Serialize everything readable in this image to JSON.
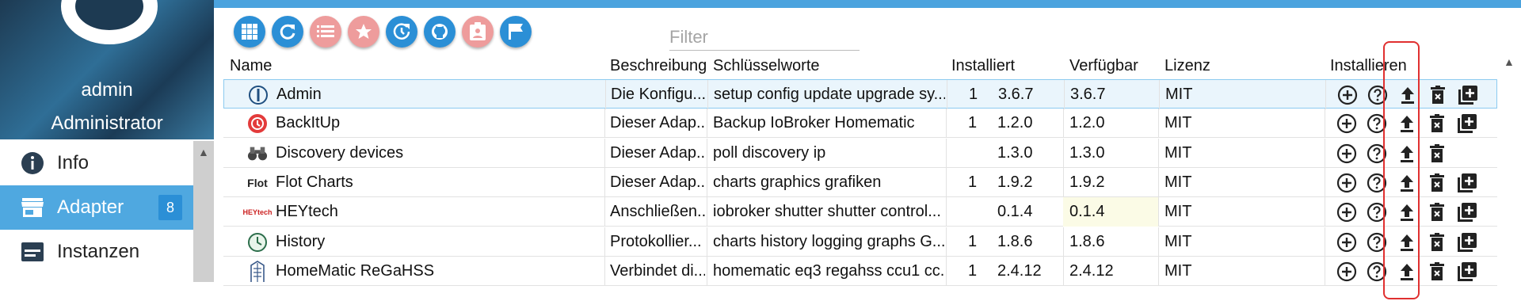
{
  "user": {
    "name": "admin",
    "role": "Administrator"
  },
  "menu": {
    "info": "Info",
    "adapter": "Adapter",
    "adapter_badge": "8",
    "instances": "Instanzen"
  },
  "filter": {
    "placeholder": "Filter"
  },
  "table": {
    "headers": {
      "name": "Name",
      "desc": "Beschreibung",
      "keywords": "Schlüsselworte",
      "installed": "Installiert",
      "available": "Verfügbar",
      "license": "Lizenz",
      "install": "Installieren"
    },
    "rows": [
      {
        "name": "Admin",
        "desc": "Die Konfigu...",
        "keywords": "setup config update upgrade sy...",
        "count": "1",
        "installed": "3.6.7",
        "available": "3.6.7",
        "license": "MIT",
        "icon": "admin-icon",
        "add": true
      },
      {
        "name": "BackItUp",
        "desc": "Dieser Adap...",
        "keywords": "Backup IoBroker Homematic",
        "count": "1",
        "installed": "1.2.0",
        "available": "1.2.0",
        "license": "MIT",
        "icon": "backitup-icon",
        "add": true
      },
      {
        "name": "Discovery devices",
        "desc": "Dieser Adap...",
        "keywords": "poll discovery ip",
        "count": "",
        "installed": "1.3.0",
        "available": "1.3.0",
        "license": "MIT",
        "icon": "binoculars-icon",
        "add": false
      },
      {
        "name": "Flot Charts",
        "desc": "Dieser Adap...",
        "keywords": "charts graphics grafiken",
        "count": "1",
        "installed": "1.9.2",
        "available": "1.9.2",
        "license": "MIT",
        "icon": "flot-icon",
        "icon_text": "Flot",
        "add": true
      },
      {
        "name": "HEYtech",
        "desc": "Anschließen...",
        "keywords": "iobroker shutter shutter control...",
        "count": "",
        "installed": "0.1.4",
        "available": "0.1.4",
        "license": "MIT",
        "icon": "heytech-icon",
        "icon_text": "HEYtech",
        "add": true
      },
      {
        "name": "History",
        "desc": "Protokollier...",
        "keywords": "charts history logging graphs G...",
        "count": "1",
        "installed": "1.8.6",
        "available": "1.8.6",
        "license": "MIT",
        "icon": "history-icon",
        "add": true
      },
      {
        "name": "HomeMatic ReGaHSS",
        "desc": "Verbindet di...",
        "keywords": "homematic eq3 regahss ccu1 cc...",
        "count": "1",
        "installed": "2.4.12",
        "available": "2.4.12",
        "license": "MIT",
        "icon": "homematic-icon",
        "add": true
      }
    ]
  },
  "colors": {
    "accent": "#2b8fd6",
    "topbar": "#4ba3de",
    "selected": "#4fa8e0",
    "annotation": "#e03030"
  }
}
